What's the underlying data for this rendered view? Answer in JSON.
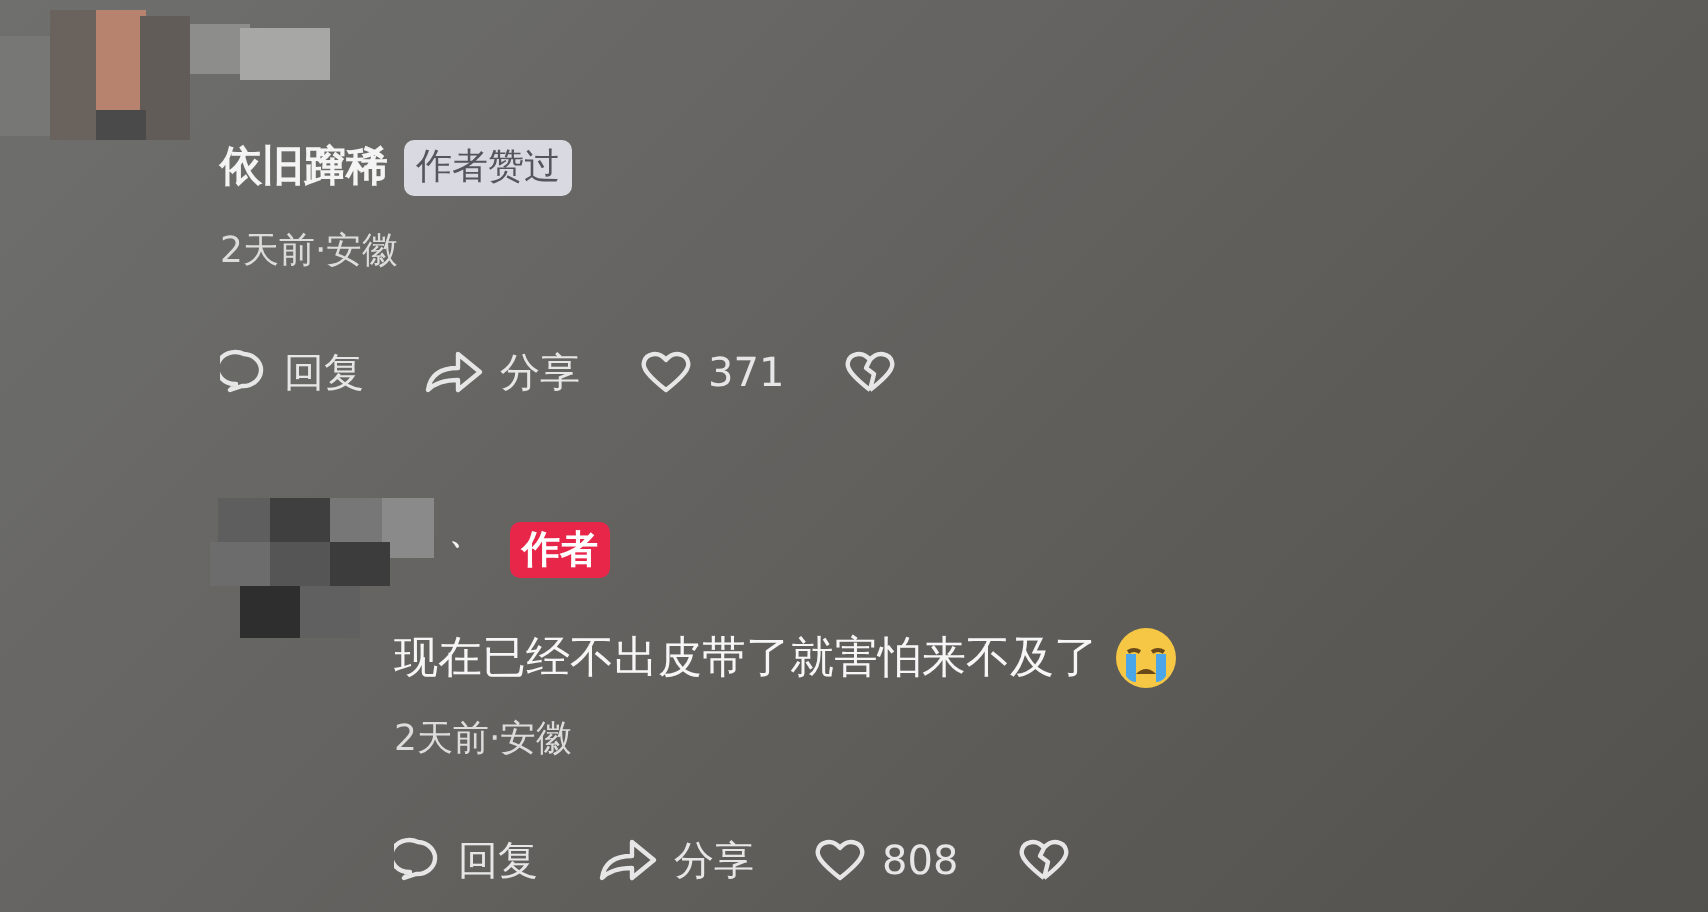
{
  "comments": [
    {
      "username": "依旧蹿稀",
      "badge": {
        "kind": "liked",
        "label": "作者赞过"
      },
      "meta": "2天前·安徽",
      "actions": {
        "reply": "回复",
        "share": "分享",
        "likes": "371"
      },
      "is_reply": false
    },
    {
      "username": "、",
      "badge": {
        "kind": "author",
        "label": "作者"
      },
      "text": "现在已经不出皮带了就害怕来不及了",
      "trailing_emoji": true,
      "meta": "2天前·安徽",
      "actions": {
        "reply": "回复",
        "share": "分享",
        "likes": "808"
      },
      "is_reply": true
    }
  ]
}
